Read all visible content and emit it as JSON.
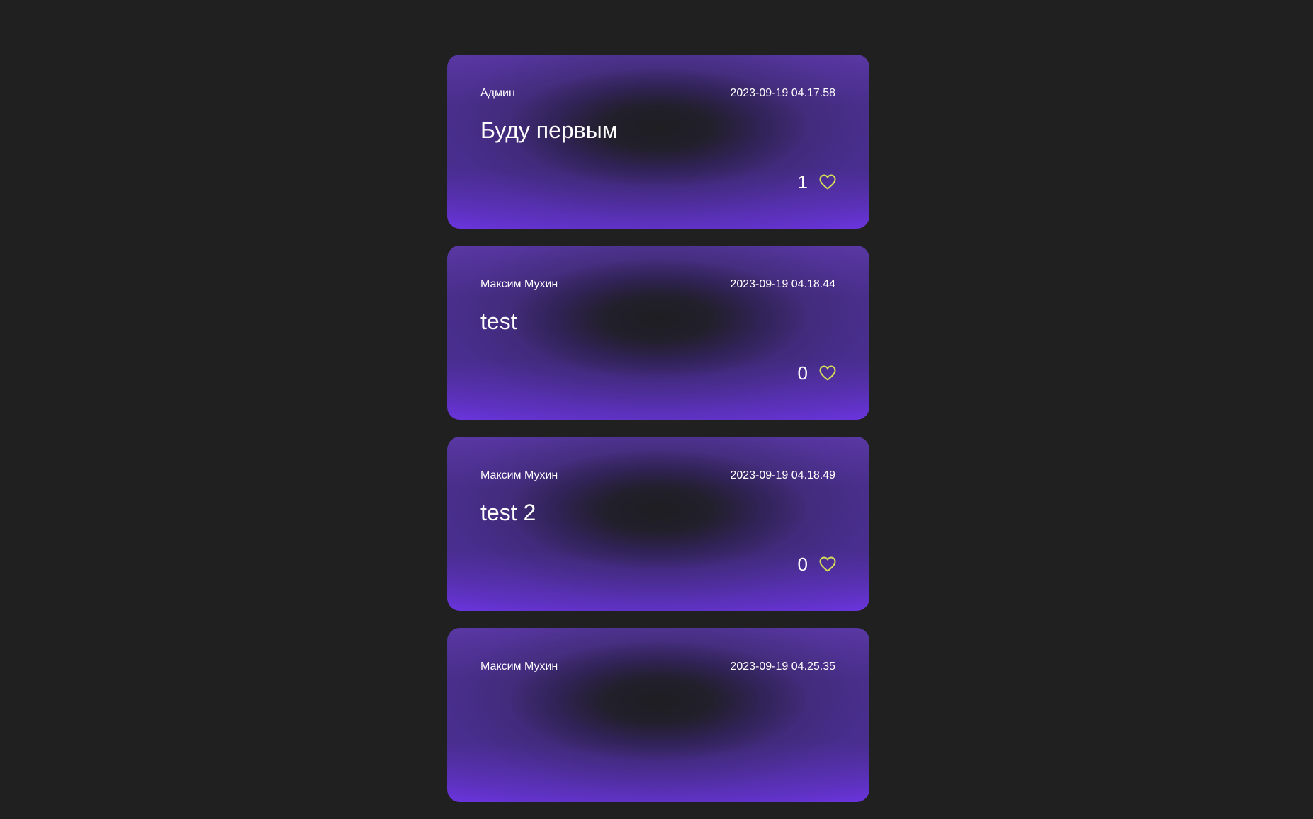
{
  "accent": {
    "heart": "#d4e157",
    "card_bottom": "#6a34dc",
    "card_top": "#5d3aa8"
  },
  "posts": [
    {
      "author": "Админ",
      "date": "2023-09-19 04.17.58",
      "text": "Буду первым",
      "likes": "1"
    },
    {
      "author": "Максим Мухин",
      "date": "2023-09-19 04.18.44",
      "text": "test",
      "likes": "0"
    },
    {
      "author": "Максим Мухин",
      "date": "2023-09-19 04.18.49",
      "text": "test 2",
      "likes": "0"
    },
    {
      "author": "Максим Мухин",
      "date": "2023-09-19 04.25.35",
      "text": "",
      "likes": ""
    }
  ]
}
